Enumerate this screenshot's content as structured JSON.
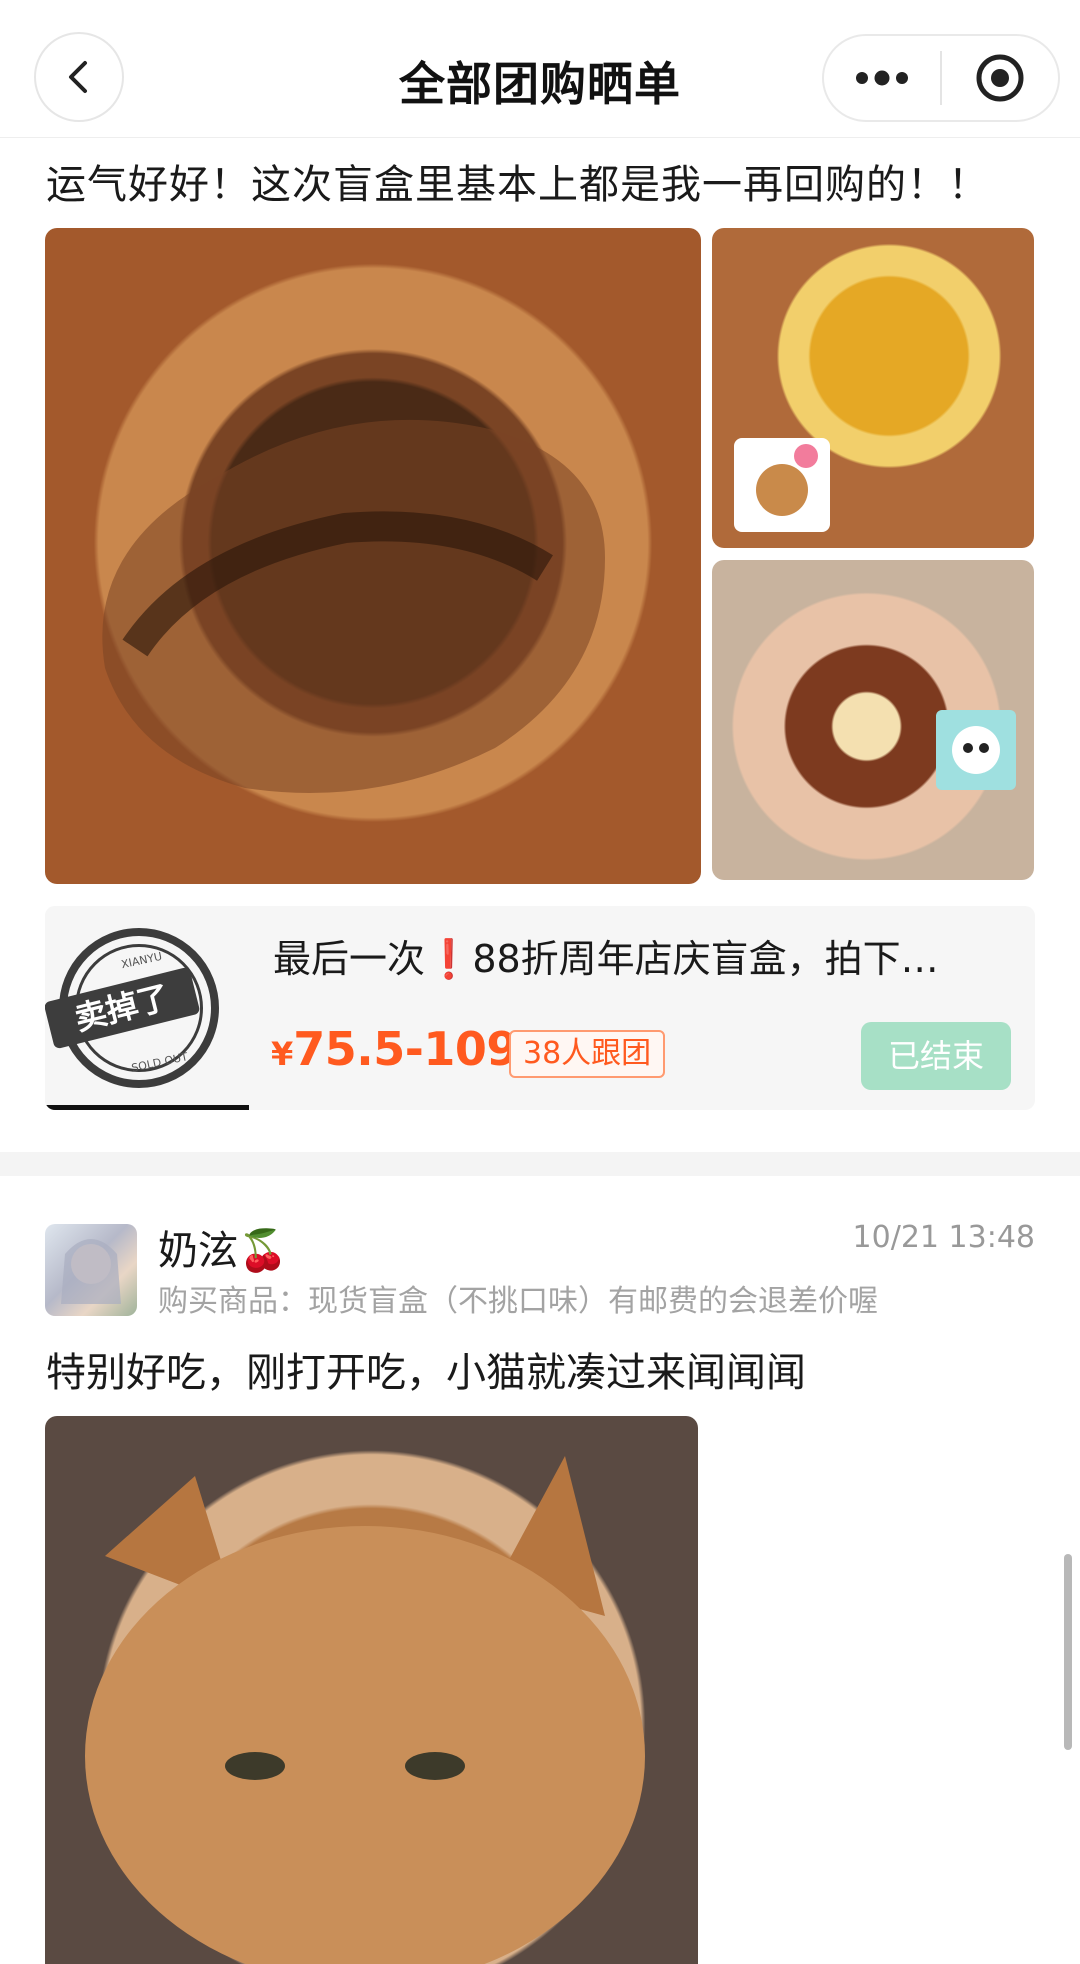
{
  "header": {
    "title": "全部团购晒单",
    "back_icon": "chevron-left-icon",
    "more_icon": "more-dots-icon",
    "record_icon": "target-circle-icon"
  },
  "post1": {
    "text": "运气好好！这次盲盒里基本上都是我一再回购的！！",
    "product": {
      "title": "最后一次❗️88折周年店庆盲盒，拍下…",
      "price_currency": "¥",
      "price_range": "75.5-109",
      "group_badge": "38人跟团",
      "status_button": "已结束",
      "stamp_label": "卖掉了",
      "stamp_top": "XIANYU",
      "stamp_bottom": "SOLD OUT"
    }
  },
  "post2": {
    "username": "奶泫🍒",
    "timestamp": "10/21 13:48",
    "purchase_info": "购买商品：现货盲盒（不挑口味）有邮费的会退差价喔",
    "text": "特别好吃，刚打开吃，小猫就凑过来闻闻闻"
  },
  "colors": {
    "price": "#ff5a1f",
    "ended_button": "#a7e0c6",
    "divider": "#f4f4f4"
  }
}
